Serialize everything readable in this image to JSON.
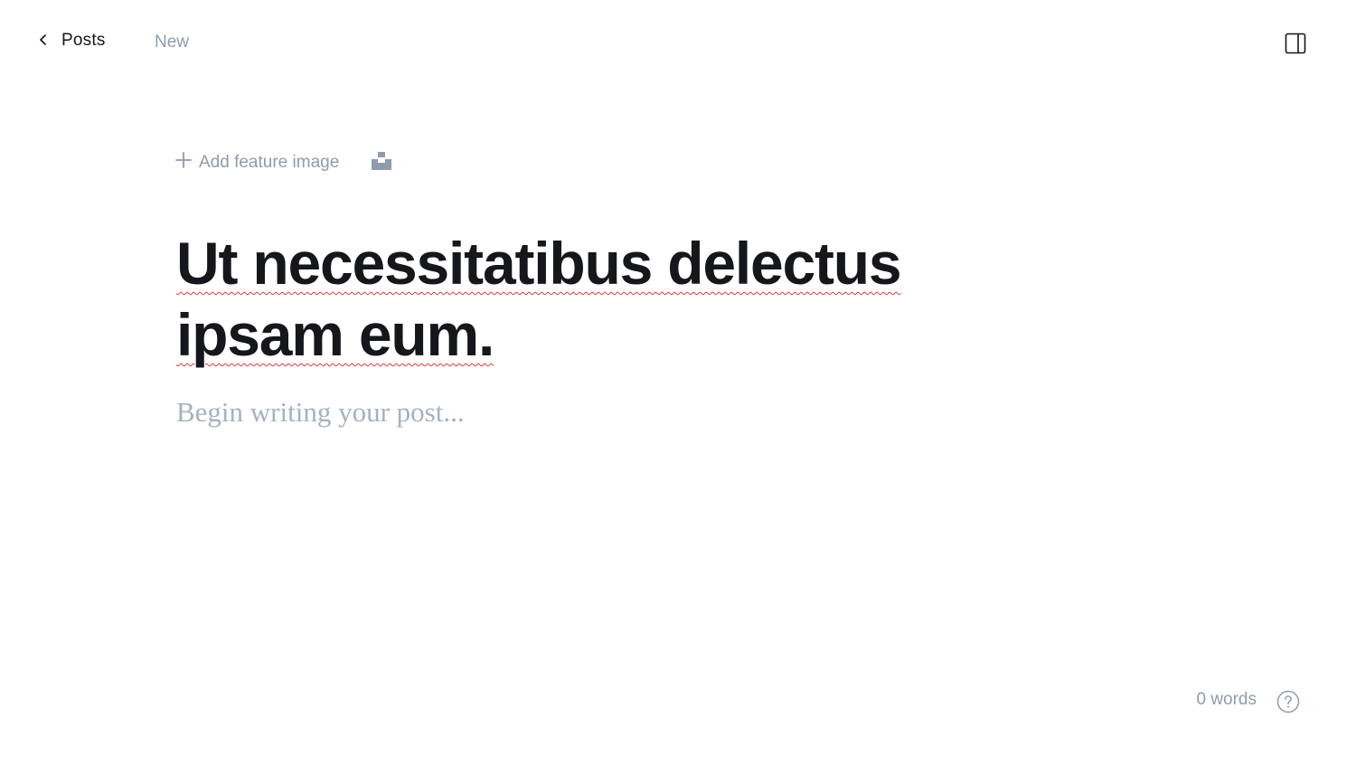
{
  "header": {
    "back_label": "Posts",
    "status": "New",
    "sidebar_toggle_icon": "sidebar-panel-icon"
  },
  "feature": {
    "add_label": "Add feature image",
    "plus_icon": "plus-icon",
    "unsplash_icon": "unsplash-icon"
  },
  "post": {
    "title": "Ut necessitatibus delectus ipsam eum.",
    "body_placeholder": "Begin writing your post..."
  },
  "footer": {
    "word_count": "0 words",
    "help_icon": "question-circle-icon"
  },
  "colors": {
    "text": "#15171a",
    "muted": "#8e9cac",
    "placeholder": "#a6b2bf",
    "spellcheck": "#e0393e"
  }
}
